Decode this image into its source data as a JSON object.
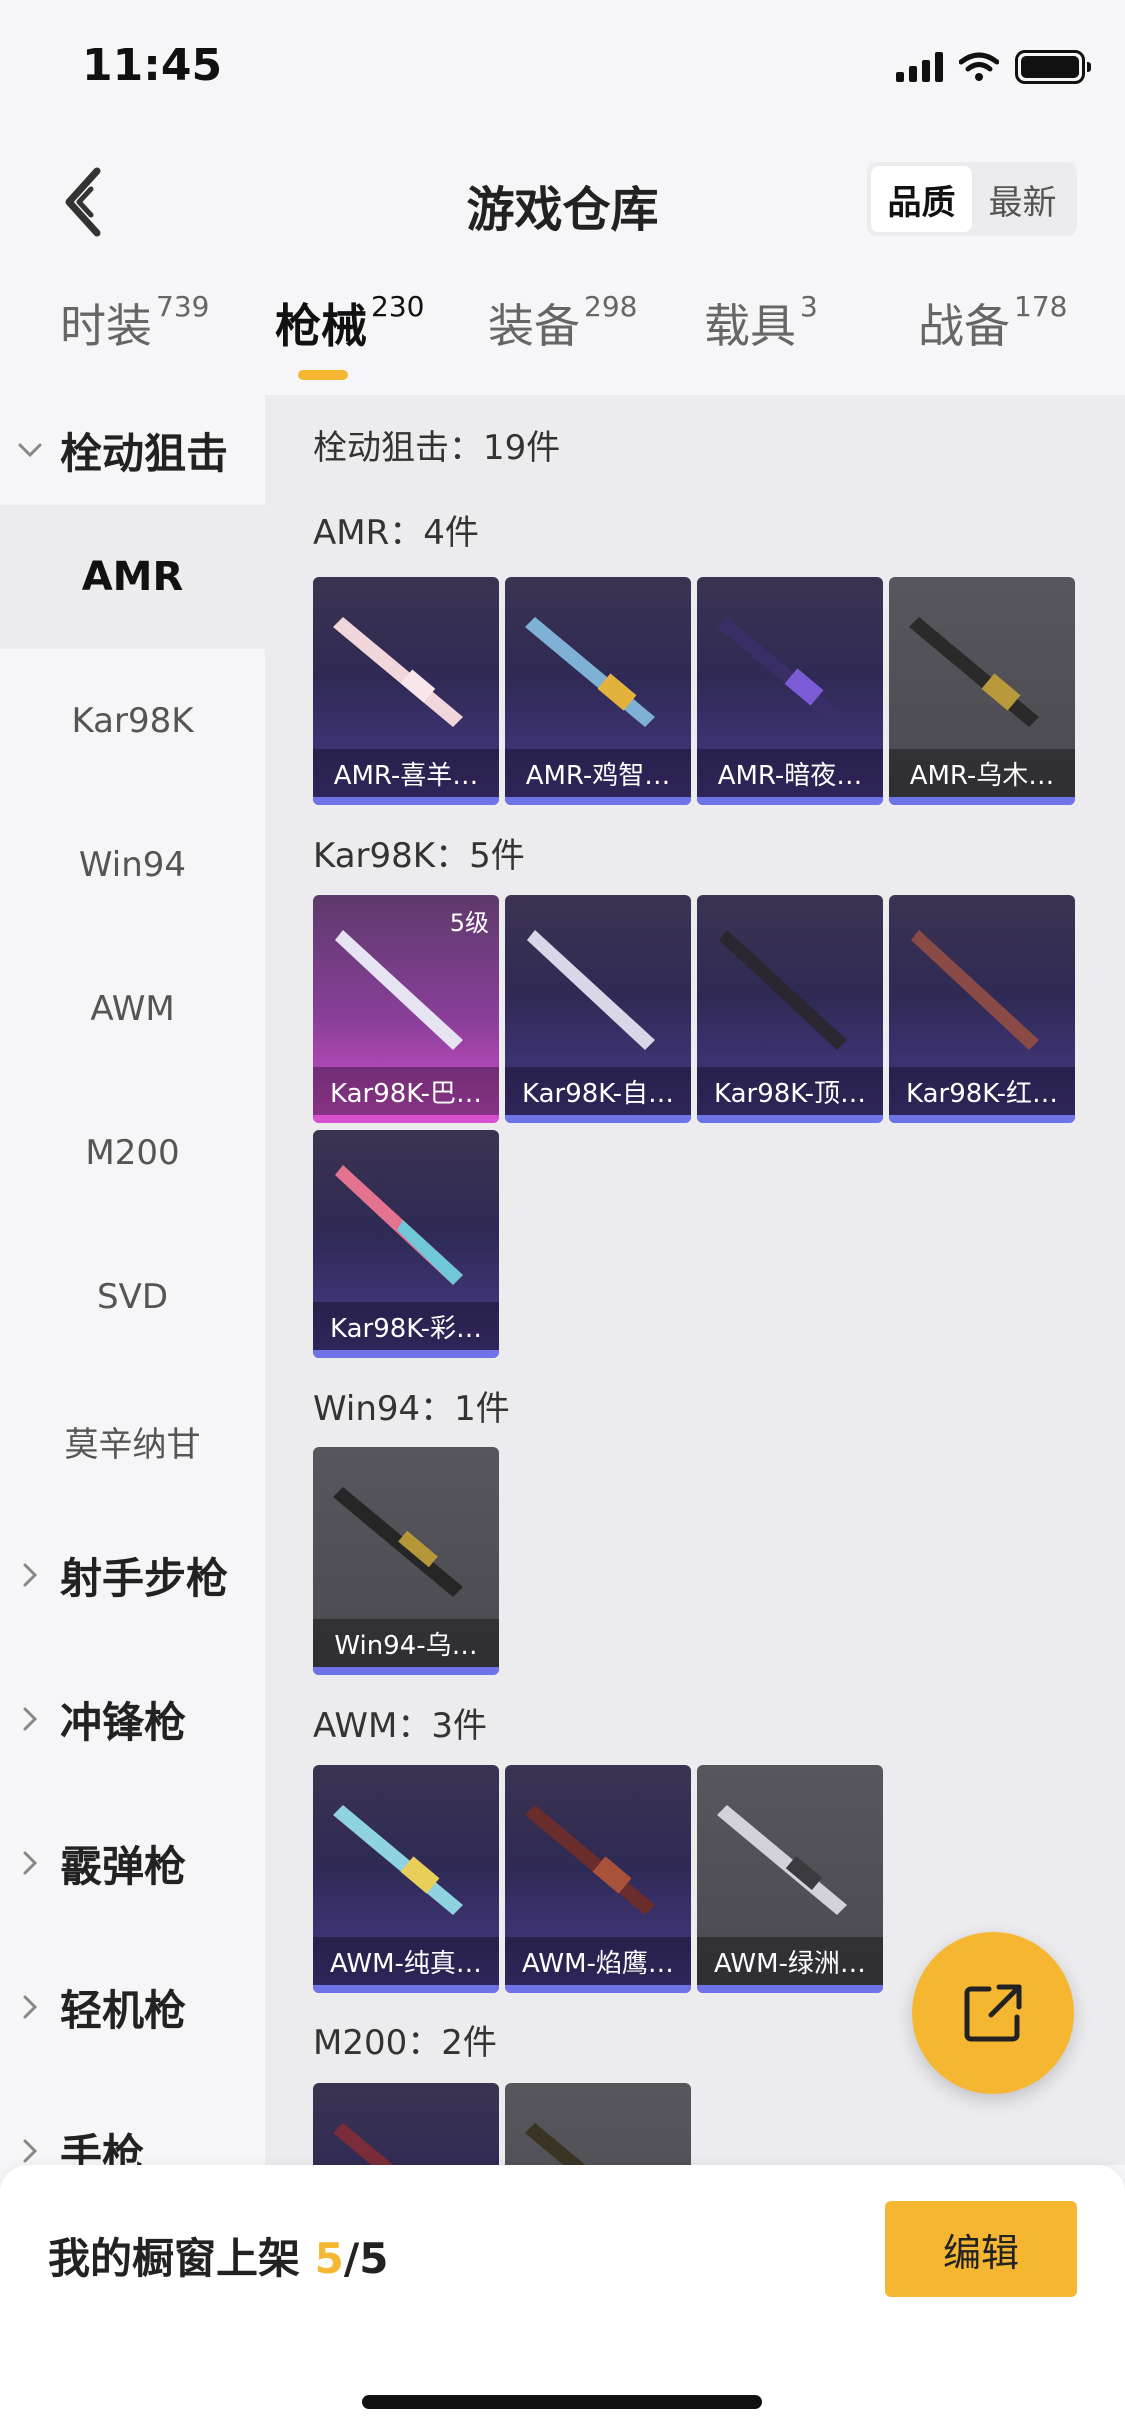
{
  "status": {
    "time": "11:45"
  },
  "header": {
    "title": "游戏仓库",
    "sort_options": [
      "品质",
      "最新"
    ],
    "sort_active": "品质"
  },
  "tabs": [
    {
      "label": "时装",
      "count": "739"
    },
    {
      "label": "枪械",
      "count": "230"
    },
    {
      "label": "装备",
      "count": "298"
    },
    {
      "label": "载具",
      "count": "3"
    },
    {
      "label": "战备",
      "count": "178"
    }
  ],
  "sidebar": {
    "group_open": "栓动狙击",
    "items": [
      "AMR",
      "Kar98K",
      "Win94",
      "AWM",
      "M200",
      "SVD",
      "莫辛纳甘"
    ],
    "groups_collapsed": [
      "射手步枪",
      "冲锋枪",
      "霰弹枪",
      "轻机枪",
      "手枪"
    ]
  },
  "main": {
    "category_total": "栓动狙击：19件",
    "sections": [
      {
        "title": "AMR：4件",
        "items": [
          "AMR-喜羊…",
          "AMR-鸡智…",
          "AMR-暗夜…",
          "AMR-乌木…"
        ]
      },
      {
        "title": "Kar98K：5件",
        "badge": "5级",
        "items": [
          "Kar98K-巴…",
          "Kar98K-自…",
          "Kar98K-顶…",
          "Kar98K-红…",
          "Kar98K-彩…"
        ]
      },
      {
        "title": "Win94：1件",
        "items": [
          "Win94-乌…"
        ]
      },
      {
        "title": "AWM：3件",
        "items": [
          "AWM-纯真…",
          "AWM-焰鹰…",
          "AWM-绿洲…"
        ]
      },
      {
        "title": "M200：2件"
      }
    ]
  },
  "bottom": {
    "showcase_label": "我的橱窗上架",
    "showcase_current": "5",
    "showcase_total": "/5",
    "edit_label": "编辑"
  },
  "colors": {
    "accent": "#f5b731",
    "rarity_bar": "#6e74e8"
  }
}
